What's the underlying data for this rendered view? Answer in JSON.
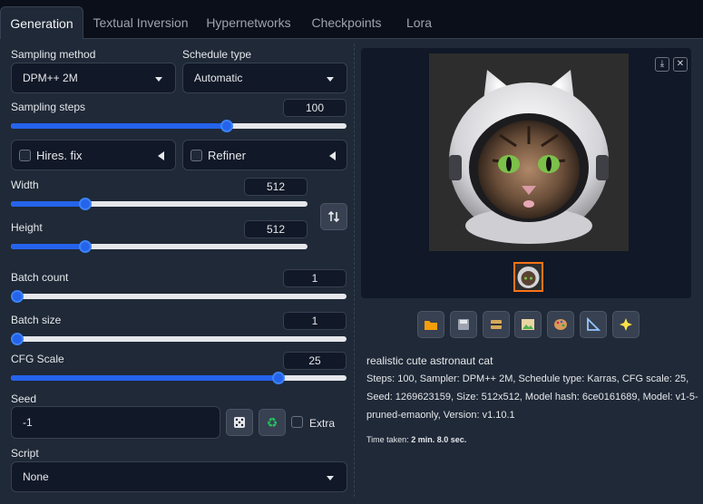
{
  "tabs": [
    "Generation",
    "Textual Inversion",
    "Hypernetworks",
    "Checkpoints",
    "Lora"
  ],
  "sampling_method": {
    "label": "Sampling method",
    "value": "DPM++ 2M"
  },
  "schedule_type": {
    "label": "Schedule type",
    "value": "Automatic"
  },
  "sampling_steps": {
    "label": "Sampling steps",
    "value": "100",
    "fraction": 0.65
  },
  "hires_fix": {
    "label": "Hires. fix"
  },
  "refiner": {
    "label": "Refiner"
  },
  "width": {
    "label": "Width",
    "value": "512",
    "fraction": 0.24
  },
  "height": {
    "label": "Height",
    "value": "512",
    "fraction": 0.24
  },
  "batch_count": {
    "label": "Batch count",
    "value": "1",
    "fraction": 0.0
  },
  "batch_size": {
    "label": "Batch size",
    "value": "1",
    "fraction": 0.0
  },
  "cfg_scale": {
    "label": "CFG Scale",
    "value": "25",
    "fraction": 0.81
  },
  "seed": {
    "label": "Seed",
    "value": "-1",
    "extra_label": "Extra"
  },
  "script": {
    "label": "Script",
    "value": "None"
  },
  "output": {
    "prompt": "realistic cute astronaut cat",
    "params_lines": [
      "Steps: 100, Sampler: DPM++ 2M, Schedule type: Karras, CFG scale: 25,",
      "Seed: 1269623159, Size: 512x512, Model hash: 6ce0161689, Model: v1-5-",
      "pruned-emaonly, Version: v1.10.1"
    ],
    "time_label": "Time taken:",
    "time_value": "2 min. 8.0 sec."
  },
  "toolbar_icons": [
    "folder-icon",
    "save-icon",
    "zip-icon",
    "image-icon",
    "palette-icon",
    "ruler-icon",
    "sparkles-icon"
  ],
  "colors": {
    "accent": "#2563eb",
    "selected_thumb_border": "#f97316"
  }
}
